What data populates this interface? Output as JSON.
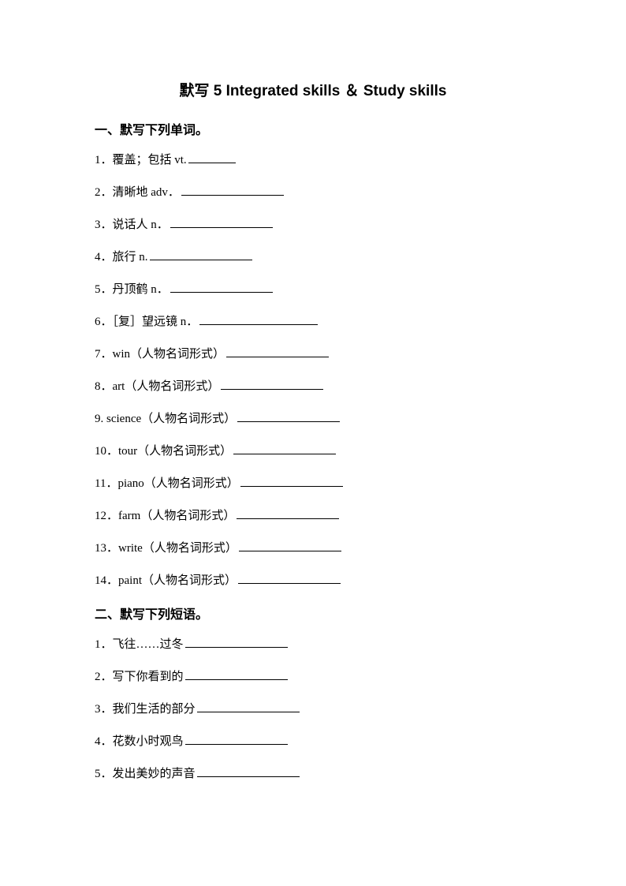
{
  "title": "默写 5 Integrated skills ＆ Study skills",
  "section1": {
    "heading": "一、默写下列单词。",
    "items": [
      "1．覆盖；包括 vt.",
      "2．清晰地 adv．",
      "3．说话人 n．",
      "4．旅行 n.",
      "5．丹顶鹤 n．",
      "6．［复］望远镜 n．",
      "7．win（人物名词形式）",
      "8．art（人物名词形式）",
      "9. science（人物名词形式）",
      "10．tour（人物名词形式）",
      "11．piano（人物名词形式）",
      "12．farm（人物名词形式）",
      "13．write（人物名词形式）",
      "14．paint（人物名词形式）"
    ]
  },
  "section2": {
    "heading": "二、默写下列短语。",
    "items": [
      "1．飞往……过冬",
      "2．写下你看到的",
      "3．我们生活的部分",
      "4．花数小时观鸟",
      "5．发出美妙的声音"
    ]
  }
}
